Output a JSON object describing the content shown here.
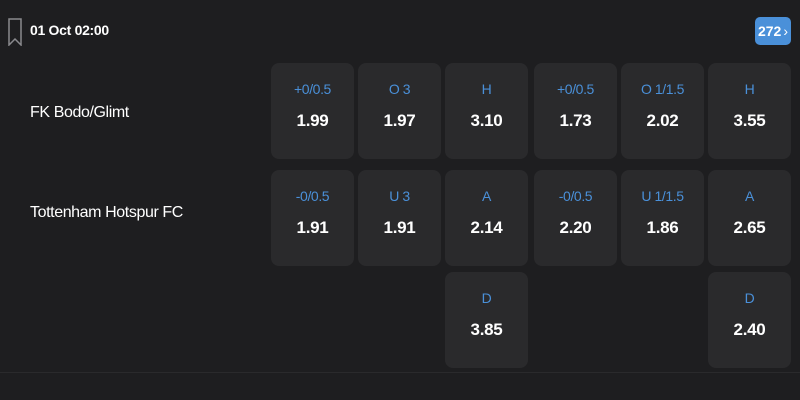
{
  "header": {
    "match_time": "01 Oct 02:00",
    "more_markets_count": "272",
    "bookmark_icon": "bookmark-icon",
    "chevron_icon": "chevron-right-icon"
  },
  "teams": {
    "home": "FK Bodo/Glimt",
    "away": "Tottenham Hotspur FC"
  },
  "odds": {
    "row1": [
      {
        "label": "+0/0.5",
        "odd": "1.99"
      },
      {
        "label": "O 3",
        "odd": "1.97"
      },
      {
        "label": "H",
        "odd": "3.10"
      },
      {
        "label": "+0/0.5",
        "odd": "1.73"
      },
      {
        "label": "O 1/1.5",
        "odd": "2.02"
      },
      {
        "label": "H",
        "odd": "3.55"
      }
    ],
    "row2": [
      {
        "label": "-0/0.5",
        "odd": "1.91"
      },
      {
        "label": "U 3",
        "odd": "1.91"
      },
      {
        "label": "A",
        "odd": "2.14"
      },
      {
        "label": "-0/0.5",
        "odd": "2.20"
      },
      {
        "label": "U 1/1.5",
        "odd": "1.86"
      },
      {
        "label": "A",
        "odd": "2.65"
      }
    ],
    "row3": [
      {
        "label": "D",
        "odd": "3.85"
      },
      {
        "label": "D",
        "odd": "2.40"
      }
    ]
  },
  "colors": {
    "background": "#1e1e20",
    "cell": "#2a2a2c",
    "accent": "#4a90d9",
    "text": "#ffffff"
  }
}
